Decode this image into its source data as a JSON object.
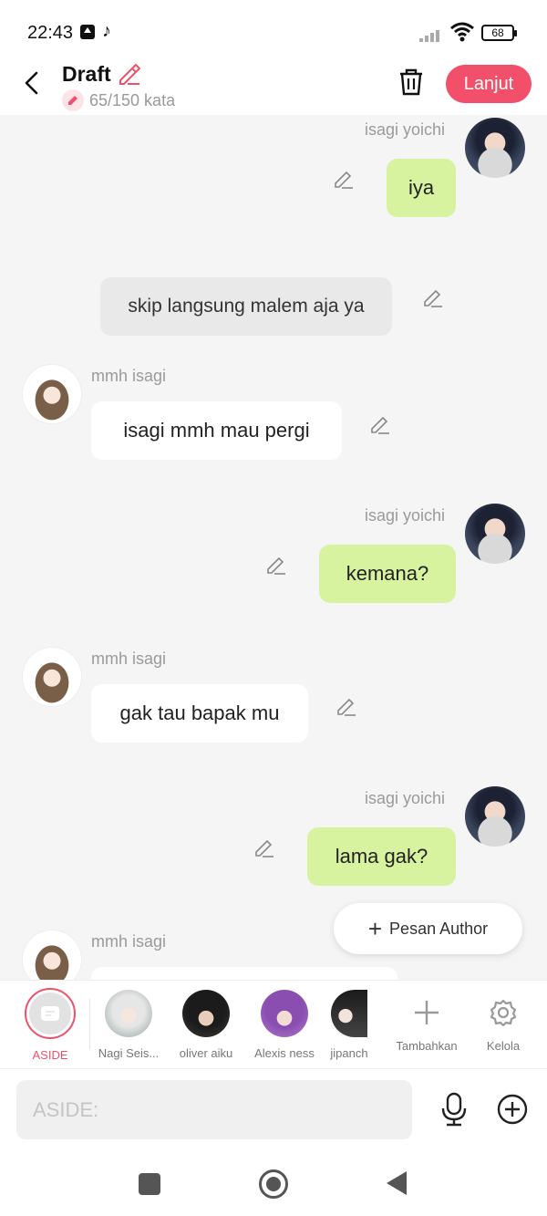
{
  "status_bar": {
    "time": "22:43",
    "battery": "68",
    "icons": [
      "upload-icon",
      "tiktok-icon",
      "signal-icon",
      "wifi-icon",
      "battery-icon"
    ]
  },
  "header": {
    "title": "Draft",
    "word_count": "65/150 kata",
    "next_label": "Lanjut",
    "accent_color": "#f2506a"
  },
  "messages": [
    {
      "sender": "isagi yoichi",
      "text": "iya",
      "side": "right",
      "color": "#d8f3a0"
    },
    {
      "sender": "",
      "text": "skip langsung malem aja ya",
      "side": "center",
      "color": "#e9e9e9"
    },
    {
      "sender": "mmh isagi",
      "text": "isagi mmh mau pergi",
      "side": "left",
      "color": "#ffffff"
    },
    {
      "sender": "isagi yoichi",
      "text": "kemana?",
      "side": "right",
      "color": "#d8f3a0"
    },
    {
      "sender": "mmh isagi",
      "text": "gak tau bapak mu",
      "side": "left",
      "color": "#ffffff"
    },
    {
      "sender": "isagi yoichi",
      "text": "lama gak?",
      "side": "right",
      "color": "#d8f3a0"
    },
    {
      "sender": "mmh isagi",
      "text": "",
      "side": "left",
      "color": "#ffffff"
    }
  ],
  "fab": {
    "label": "Pesan Author"
  },
  "characters": [
    {
      "label": "ASIDE",
      "selected": true
    },
    {
      "label": "Nagi Seis..."
    },
    {
      "label": "oliver aiku"
    },
    {
      "label": "Alexis ness"
    },
    {
      "label": "jipanch"
    },
    {
      "label": "Tambahkan"
    },
    {
      "label": "Kelola"
    }
  ],
  "input": {
    "placeholder": "ASIDE:"
  }
}
